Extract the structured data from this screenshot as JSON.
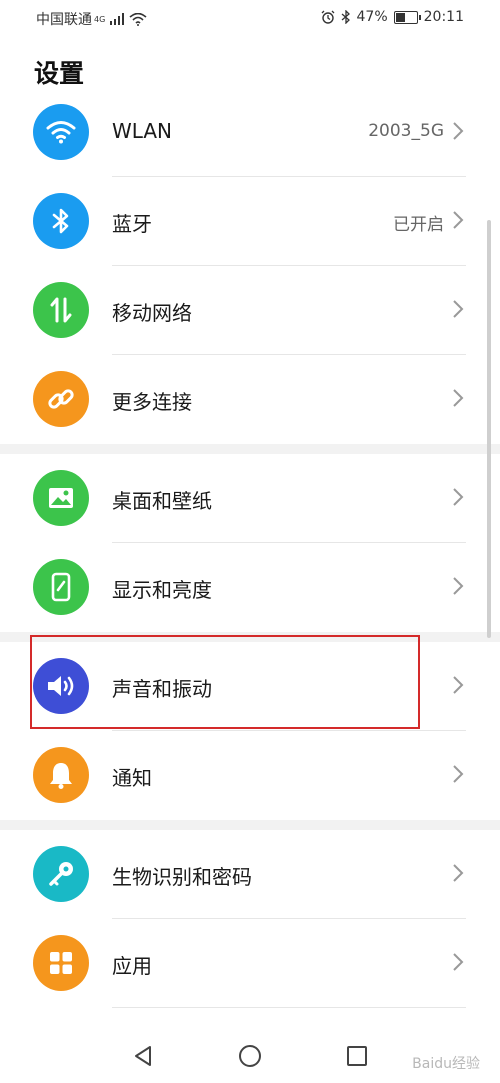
{
  "status_bar": {
    "carrier": "中国联通",
    "network_type": "4G",
    "battery_percent": "47%",
    "battery_level": 0.47,
    "time": "20:11"
  },
  "page_title": "设置",
  "items": [
    {
      "label": "WLAN",
      "value": "2003_5G",
      "icon": "wifi-icon",
      "color": "#1a9cf0"
    },
    {
      "label": "蓝牙",
      "value": "已开启",
      "icon": "bluetooth-icon",
      "color": "#1a9cf0"
    },
    {
      "label": "移动网络",
      "value": "",
      "icon": "mobile-data-icon",
      "color": "#3cc44b"
    },
    {
      "label": "更多连接",
      "value": "",
      "icon": "link-icon",
      "color": "#f5961d"
    },
    {
      "label": "桌面和壁纸",
      "value": "",
      "icon": "image-icon",
      "color": "#3cc44b"
    },
    {
      "label": "显示和亮度",
      "value": "",
      "icon": "display-icon",
      "color": "#3cc44b"
    },
    {
      "label": "声音和振动",
      "value": "",
      "icon": "speaker-icon",
      "color": "#3e4ed6"
    },
    {
      "label": "通知",
      "value": "",
      "icon": "bell-icon",
      "color": "#f5961d"
    },
    {
      "label": "生物识别和密码",
      "value": "",
      "icon": "key-icon",
      "color": "#19b9c6"
    },
    {
      "label": "应用",
      "value": "",
      "icon": "apps-icon",
      "color": "#f5961d"
    }
  ],
  "watermark": "Baidu经验"
}
